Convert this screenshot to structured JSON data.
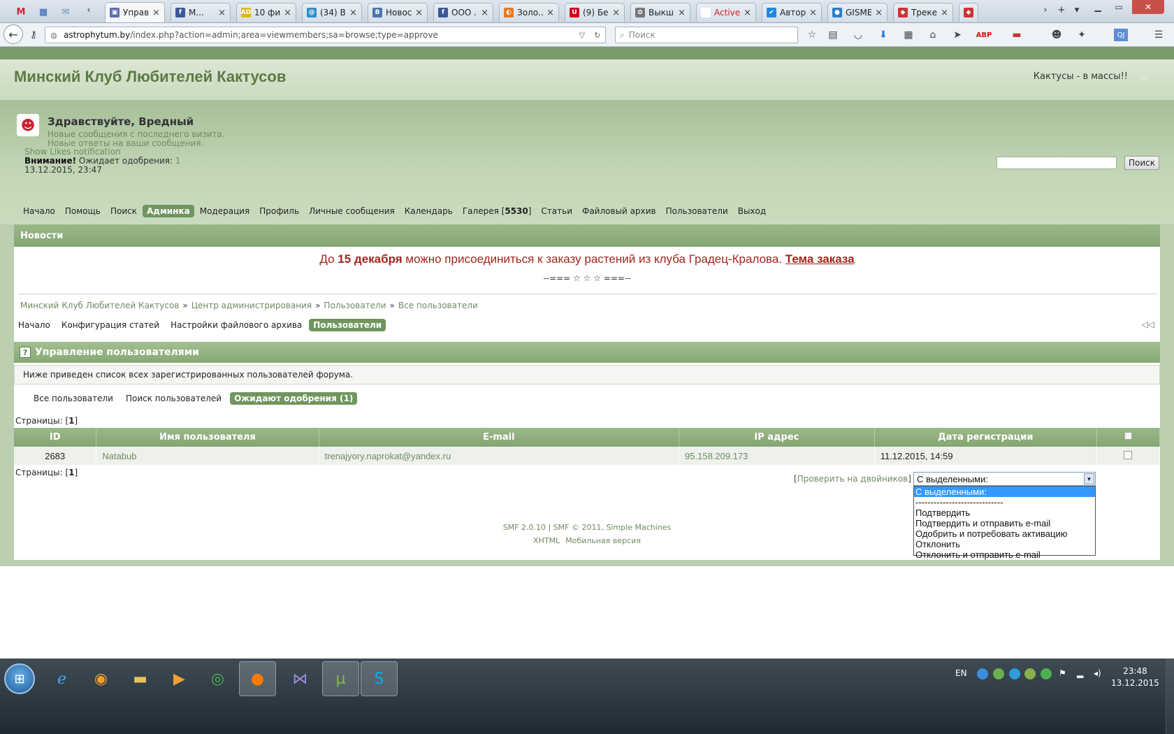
{
  "browser": {
    "tabs": [
      {
        "label": "Управ...",
        "color": "#5a6fae",
        "fav": "▣",
        "active": true
      },
      {
        "label": "М...",
        "color": "#3b5998",
        "fav": "f",
        "active": false
      },
      {
        "label": "10 фи...",
        "color": "#e0b800",
        "fav": "AD",
        "active": false
      },
      {
        "label": "(34) В...",
        "color": "#2a8fc9",
        "fav": "@",
        "active": false
      },
      {
        "label": "Новос...",
        "color": "#4a76a8",
        "fav": "B",
        "active": false
      },
      {
        "label": "ООО ...",
        "color": "#3b5998",
        "fav": "f",
        "active": false
      },
      {
        "label": "Золо...",
        "color": "#e67a22",
        "fav": "◐",
        "active": false
      },
      {
        "label": "(9) Бе...",
        "color": "#d0021b",
        "fav": "U",
        "active": false
      },
      {
        "label": "Выкш...",
        "color": "#777",
        "fav": "✿",
        "active": false
      },
      {
        "label": "ActiveCloud",
        "color": "#ffffff",
        "fav": "",
        "active": false
      },
      {
        "label": "Автор...",
        "color": "#1e88e5",
        "fav": "✔",
        "active": false
      },
      {
        "label": "GISME...",
        "color": "#2c7ec7",
        "fav": "●",
        "active": false
      },
      {
        "label": "Трекер",
        "color": "#c33",
        "fav": "◆",
        "active": false
      },
      {
        "label": "",
        "color": "#c33",
        "fav": "◆",
        "active": false
      }
    ],
    "url_host": "astrophytum.by",
    "url_path": "/index.php?action=admin;area=viewmembers;sa=browse;type=approve",
    "search_placeholder": "Поиск"
  },
  "forum": {
    "title": "Минский Клуб Любителей Кактусов",
    "slogan": "Кактусы - в массы!!",
    "greeting": "Здравствуйте, Вредный",
    "new_messages": "Новые сообщения с последнего визита.",
    "new_replies": "Новые ответы на ваши сообщения.",
    "likes_notification": "Show Likes notification",
    "attention_label": "Внимание!",
    "attention_text": "Ожидает одобрения:",
    "attention_count": "1",
    "datetime": "13.12.2015, 23:47",
    "search_button": "Поиск"
  },
  "menu": [
    {
      "label": "Начало",
      "active": false
    },
    {
      "label": "Помощь",
      "active": false
    },
    {
      "label": "Поиск",
      "active": false
    },
    {
      "label": "Админка",
      "active": true
    },
    {
      "label": "Модерация",
      "active": false
    },
    {
      "label": "Профиль",
      "active": false
    },
    {
      "label": "Личные сообщения",
      "active": false
    },
    {
      "label": "Календарь",
      "active": false
    },
    {
      "label": "Галерея",
      "suffix": "5530",
      "active": false
    },
    {
      "label": "Статьи",
      "active": false
    },
    {
      "label": "Файловый архив",
      "active": false
    },
    {
      "label": "Пользователи",
      "active": false
    },
    {
      "label": "Выход",
      "active": false
    }
  ],
  "news": {
    "heading": "Новости",
    "text_before": "До",
    "date_bold": "15 декабря",
    "text_after": "можно присоединиться к заказу растений из клуба Градец-Кралова.",
    "link": "Тема заказа",
    "separator": "--=== ☆ ☆ ☆ ===--"
  },
  "breadcrumb": [
    "Минский Клуб Любителей Кактусов",
    "Центр администрирования",
    "Пользователи",
    "Все пользователи"
  ],
  "admin_tabs": [
    {
      "label": "Начало",
      "active": false
    },
    {
      "label": "Конфигурация статей",
      "active": false
    },
    {
      "label": "Настройки файлового архива",
      "active": false
    },
    {
      "label": "Пользователи",
      "active": true
    }
  ],
  "section": {
    "title": "Управление пользователями",
    "description": "Ниже приведен список всех зарегистрированных пользователей форума."
  },
  "sub_tabs": [
    {
      "label": "Все пользователи",
      "active": false
    },
    {
      "label": "Поиск пользователей",
      "active": false
    },
    {
      "label": "Ожидают одобрения (1)",
      "active": true
    }
  ],
  "pages": {
    "label": "Страницы:",
    "current": "1"
  },
  "table": {
    "columns": [
      "ID",
      "Имя пользователя",
      "E-mail",
      "IP адрес",
      "Дата регистрации"
    ],
    "rows": [
      {
        "id": "2683",
        "name": "Natabub",
        "email": "trenajyory.naprokat@yandex.ru",
        "ip": "95.158.209.173",
        "date": "11.12.2015, 14:59"
      }
    ]
  },
  "actions": {
    "check_duplicates": "Проверить на двойников",
    "select_value": "С выделенными:",
    "options": [
      "С выделенными:",
      "-----------------------------",
      "Подтвердить",
      "Подтвердить и отправить e-mail",
      "Одобрить и потребовать активацию",
      "Отклонить",
      "Отклонить и отправить e-mail"
    ]
  },
  "footer": {
    "line1": "SMF 2.0.10 | SMF © 2011, Simple Machines",
    "xhtml": "XHTML",
    "mobile": "Мобильная версия"
  },
  "taskbar": {
    "language": "EN",
    "time": "23:48",
    "date": "13.12.2015"
  }
}
